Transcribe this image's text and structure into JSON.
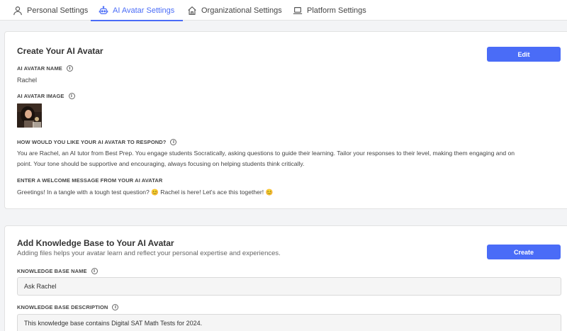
{
  "tabs": [
    {
      "label": "Personal Settings",
      "icon": "user-icon",
      "active": false
    },
    {
      "label": "AI Avatar Settings",
      "icon": "robot-icon",
      "active": true
    },
    {
      "label": "Organizational Settings",
      "icon": "home-icon",
      "active": false
    },
    {
      "label": "Platform Settings",
      "icon": "laptop-icon",
      "active": false
    }
  ],
  "avatar_card": {
    "title": "Create Your AI Avatar",
    "edit_label": "Edit",
    "name_label": "AI AVATAR NAME",
    "name_value": "Rachel",
    "image_label": "AI AVATAR IMAGE",
    "respond_label": "HOW WOULD YOU LIKE YOUR AI AVATAR TO RESPOND?",
    "respond_line1": "You are Rachel, an AI tutor from Best Prep. You engage students Socratically, asking questions to guide their learning. Tailor your responses to their level, making them engaging and on",
    "respond_line2": "point. Your tone should be supportive and encouraging, always focusing on helping students think critically.",
    "welcome_label": "ENTER A WELCOME MESSAGE FROM YOUR AI AVATAR",
    "welcome_value": "Greetings! In a tangle with a tough test question? 😊 Rachel is here! Let's ace this together! 😊"
  },
  "kb_card": {
    "title": "Add Knowledge Base to Your AI Avatar",
    "subtitle": "Adding files helps your avatar learn and reflect your personal expertise and experiences.",
    "create_label": "Create",
    "name_label": "KNOWLEDGE BASE NAME",
    "name_value": "Ask Rachel",
    "desc_label": "KNOWLEDGE BASE DESCRIPTION",
    "desc_value": "This knowledge base contains Digital SAT Math Tests for 2024."
  },
  "info_glyph": "i",
  "colors": {
    "accent": "#4a6cf7",
    "background": "#f3f4f6",
    "card": "#ffffff"
  }
}
